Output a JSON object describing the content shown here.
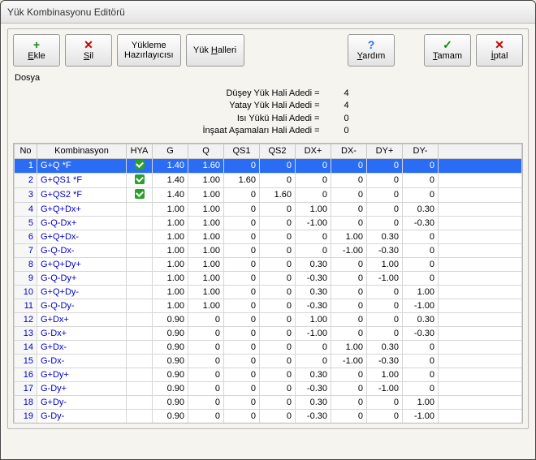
{
  "window": {
    "title": "Yük Kombinasyonu Editörü"
  },
  "toolbar": {
    "add": {
      "label": "Ekle",
      "ul": "E"
    },
    "delete": {
      "label": "Sil",
      "ul": "S"
    },
    "wizard": {
      "label": "Yükleme\nHazırlayıcısı"
    },
    "cases": {
      "label": "Yük Halleri",
      "ul": "H"
    },
    "help": {
      "label": "Yardım",
      "ul": "Y"
    },
    "ok": {
      "label": "Tamam",
      "ul": "T"
    },
    "cancel": {
      "label": "İptal",
      "ul": "İ"
    }
  },
  "menu": {
    "file": "Dosya"
  },
  "stats": [
    {
      "label": "Düşey Yük Hali Adedi =",
      "value": "4"
    },
    {
      "label": "Yatay Yük Hali Adedi =",
      "value": "4"
    },
    {
      "label": "Isı Yükü Hali Adedi =",
      "value": "0"
    },
    {
      "label": "İnşaat Aşamaları Hali Adedi =",
      "value": "0"
    }
  ],
  "table": {
    "columns": [
      "No",
      "Kombinasyon",
      "HYA",
      "G",
      "Q",
      "QS1",
      "QS2",
      "DX+",
      "DX-",
      "DY+",
      "DY-"
    ],
    "rows": [
      {
        "no": 1,
        "komb": "G+Q *F",
        "hya": true,
        "vals": [
          "1.40",
          "1.60",
          "0",
          "0",
          "0",
          "0",
          "0",
          "0"
        ],
        "selected": true
      },
      {
        "no": 2,
        "komb": "G+QS1 *F",
        "hya": true,
        "vals": [
          "1.40",
          "1.00",
          "1.60",
          "0",
          "0",
          "0",
          "0",
          "0"
        ]
      },
      {
        "no": 3,
        "komb": "G+QS2 *F",
        "hya": true,
        "vals": [
          "1.40",
          "1.00",
          "0",
          "1.60",
          "0",
          "0",
          "0",
          "0"
        ]
      },
      {
        "no": 4,
        "komb": "G+Q+Dx+",
        "hya": false,
        "vals": [
          "1.00",
          "1.00",
          "0",
          "0",
          "1.00",
          "0",
          "0",
          "0.30"
        ]
      },
      {
        "no": 5,
        "komb": "G-Q-Dx+",
        "hya": false,
        "vals": [
          "1.00",
          "1.00",
          "0",
          "0",
          "-1.00",
          "0",
          "0",
          "-0.30"
        ]
      },
      {
        "no": 6,
        "komb": "G+Q+Dx-",
        "hya": false,
        "vals": [
          "1.00",
          "1.00",
          "0",
          "0",
          "0",
          "1.00",
          "0.30",
          "0"
        ]
      },
      {
        "no": 7,
        "komb": "G-Q-Dx-",
        "hya": false,
        "vals": [
          "1.00",
          "1.00",
          "0",
          "0",
          "0",
          "-1.00",
          "-0.30",
          "0"
        ]
      },
      {
        "no": 8,
        "komb": "G+Q+Dy+",
        "hya": false,
        "vals": [
          "1.00",
          "1.00",
          "0",
          "0",
          "0.30",
          "0",
          "1.00",
          "0"
        ]
      },
      {
        "no": 9,
        "komb": "G-Q-Dy+",
        "hya": false,
        "vals": [
          "1.00",
          "1.00",
          "0",
          "0",
          "-0.30",
          "0",
          "-1.00",
          "0"
        ]
      },
      {
        "no": 10,
        "komb": "G+Q+Dy-",
        "hya": false,
        "vals": [
          "1.00",
          "1.00",
          "0",
          "0",
          "0.30",
          "0",
          "0",
          "1.00"
        ]
      },
      {
        "no": 11,
        "komb": "G-Q-Dy-",
        "hya": false,
        "vals": [
          "1.00",
          "1.00",
          "0",
          "0",
          "-0.30",
          "0",
          "0",
          "-1.00"
        ]
      },
      {
        "no": 12,
        "komb": "G+Dx+",
        "hya": false,
        "vals": [
          "0.90",
          "0",
          "0",
          "0",
          "1.00",
          "0",
          "0",
          "0.30"
        ]
      },
      {
        "no": 13,
        "komb": "G-Dx+",
        "hya": false,
        "vals": [
          "0.90",
          "0",
          "0",
          "0",
          "-1.00",
          "0",
          "0",
          "-0.30"
        ]
      },
      {
        "no": 14,
        "komb": "G+Dx-",
        "hya": false,
        "vals": [
          "0.90",
          "0",
          "0",
          "0",
          "0",
          "1.00",
          "0.30",
          "0"
        ]
      },
      {
        "no": 15,
        "komb": "G-Dx-",
        "hya": false,
        "vals": [
          "0.90",
          "0",
          "0",
          "0",
          "0",
          "-1.00",
          "-0.30",
          "0"
        ]
      },
      {
        "no": 16,
        "komb": "G+Dy+",
        "hya": false,
        "vals": [
          "0.90",
          "0",
          "0",
          "0",
          "0.30",
          "0",
          "1.00",
          "0"
        ]
      },
      {
        "no": 17,
        "komb": "G-Dy+",
        "hya": false,
        "vals": [
          "0.90",
          "0",
          "0",
          "0",
          "-0.30",
          "0",
          "-1.00",
          "0"
        ]
      },
      {
        "no": 18,
        "komb": "G+Dy-",
        "hya": false,
        "vals": [
          "0.90",
          "0",
          "0",
          "0",
          "0.30",
          "0",
          "0",
          "1.00"
        ]
      },
      {
        "no": 19,
        "komb": "G-Dy-",
        "hya": false,
        "vals": [
          "0.90",
          "0",
          "0",
          "0",
          "-0.30",
          "0",
          "0",
          "-1.00"
        ]
      }
    ]
  }
}
